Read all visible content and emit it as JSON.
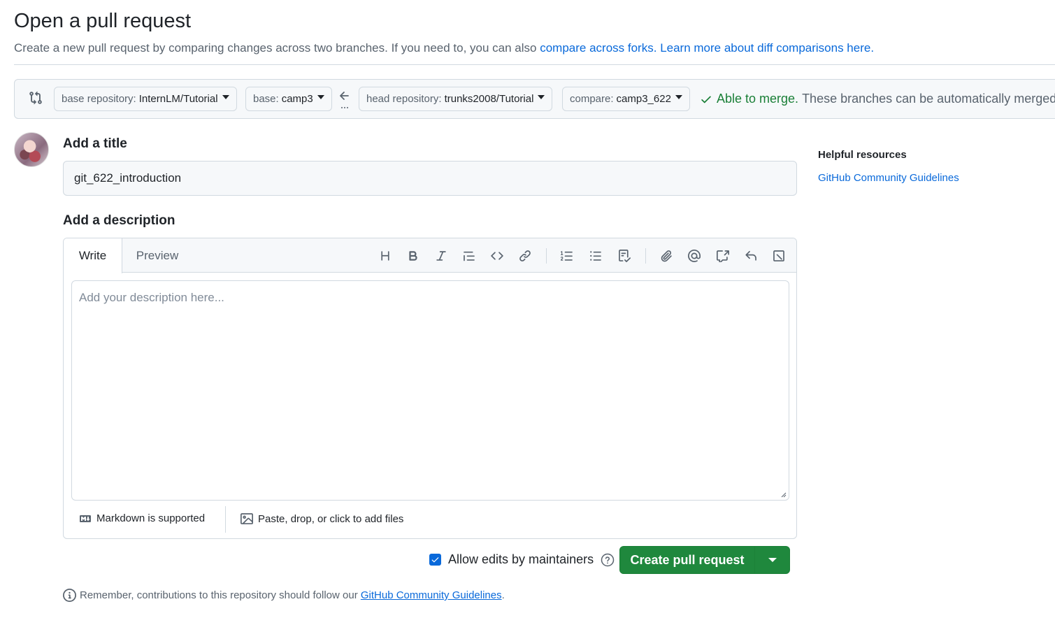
{
  "page": {
    "title": "Open a pull request",
    "subtitle_prefix": "Create a new pull request by comparing changes across two branches. If you need to, you can also ",
    "compare_forks_link": "compare across forks.",
    "learn_more_link": "Learn more about diff comparisons here."
  },
  "range": {
    "base_repo_label": "base repository:",
    "base_repo_value": "InternLM/Tutorial",
    "base_label": "base:",
    "base_value": "camp3",
    "head_repo_label": "head repository:",
    "head_repo_value": "trunks2008/Tutorial",
    "compare_label": "compare:",
    "compare_value": "camp3_622",
    "merge_status": "Able to merge.",
    "merge_message": "These branches can be automatically merged."
  },
  "form": {
    "title_label": "Add a title",
    "title_value": "git_622_introduction",
    "description_label": "Add a description",
    "tab_write": "Write",
    "tab_preview": "Preview",
    "description_placeholder": "Add your description here...",
    "markdown_note": "Markdown is supported",
    "files_note": "Paste, drop, or click to add files",
    "allow_edits": "Allow edits by maintainers",
    "allow_edits_checked": true,
    "create_button": "Create pull request",
    "remember_text": "Remember, contributions to this repository should follow our ",
    "remember_link": "GitHub Community Guidelines",
    "remember_end": "."
  },
  "sidebar": {
    "title": "Helpful resources",
    "link": "GitHub Community Guidelines"
  },
  "toolbar_icons": [
    "heading-icon",
    "bold-icon",
    "italic-icon",
    "quote-icon",
    "code-icon",
    "link-icon",
    "numbered-list-icon",
    "unordered-list-icon",
    "task-list-icon",
    "attach-icon",
    "mention-icon",
    "reference-icon",
    "undo-icon",
    "slash-command-icon"
  ],
  "colors": {
    "accent": "#0969da",
    "success": "#1a7f37",
    "primary_button": "#1f883d"
  }
}
